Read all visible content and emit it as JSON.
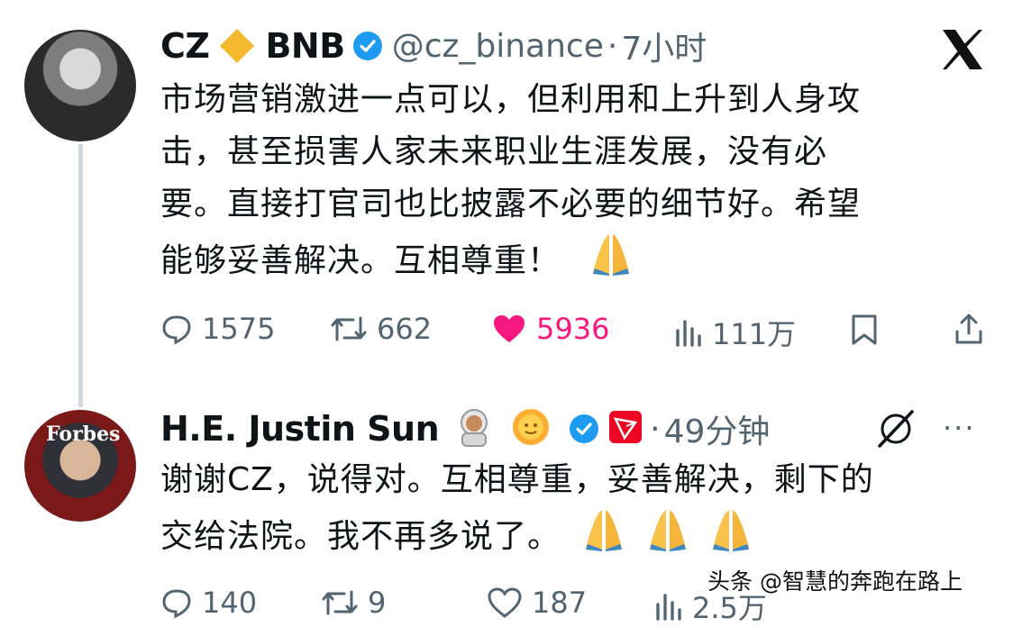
{
  "tweet1": {
    "name": "CZ",
    "name_suffix": "BNB",
    "handle": "@cz_binance",
    "separator": "·",
    "time": "7小时",
    "text_line1": "市场营销激进一点可以，但利用和上升到人身攻",
    "text_line2": "击，甚至损害人家未来职业生涯发展，没有必",
    "text_line3": "要。直接打官司也比披露不必要的细节好。希望",
    "text_line4": "能够妥善解决。互相尊重！",
    "metrics": {
      "replies": "1575",
      "retweets": "662",
      "likes": "5936",
      "views": "111万"
    }
  },
  "tweet2": {
    "name": "H.E. Justin Sun",
    "separator": "·",
    "time": "49分钟",
    "text_line1": "谢谢CZ，说得对。互相尊重，妥善解决，剩下的",
    "text_line2": "交给法院。我不再多说了。",
    "metrics": {
      "replies": "140",
      "retweets": "9",
      "likes": "187",
      "views": "2.5万"
    }
  },
  "avatar2_text": "Forbes",
  "more_label": "···",
  "watermark": "头条 @智慧的奔跑在路上",
  "colors": {
    "text": "#0f1419",
    "muted": "#536471",
    "verified": "#1d9bf0",
    "like": "#f91880",
    "bnb": "#f3ba2f",
    "tron": "#ec0623",
    "thread_line": "#cfd9de"
  }
}
